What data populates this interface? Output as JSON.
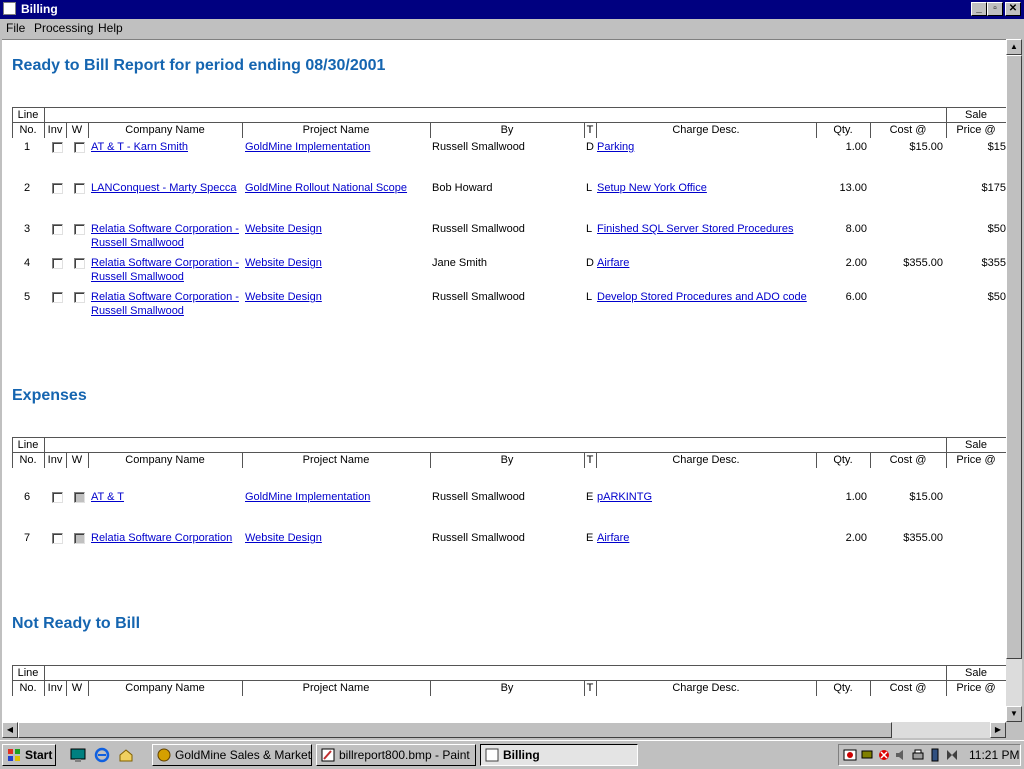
{
  "window": {
    "title": "Billing"
  },
  "menu": [
    "File",
    "Processing",
    "Help"
  ],
  "headers": {
    "line": "Line",
    "no": "No.",
    "inv": "Inv",
    "w": "W",
    "company": "Company Name",
    "project": "Project Name",
    "by": "By",
    "t": "T",
    "charge": "Charge Desc.",
    "qty": "Qty.",
    "cost": "Cost @",
    "sale": "Sale",
    "price": "Price @"
  },
  "sections": [
    {
      "title": "Ready to Bill Report for period ending 08/30/2001"
    },
    {
      "title": "Expenses"
    },
    {
      "title": "Not Ready to Bill"
    }
  ],
  "ready_rows": [
    {
      "no": "1",
      "company1": "AT & T - Karn Smith",
      "company2": "",
      "project": "GoldMine Implementation",
      "by": "Russell Smallwood",
      "t": "D",
      "charge": "Parking",
      "qty": "1.00",
      "cost": "$15.00",
      "price": "$15"
    },
    {
      "no": "2",
      "company1": "LANConquest - Marty Specca",
      "company2": "",
      "project": "GoldMine Rollout National Scope",
      "by": "Bob Howard",
      "t": "L",
      "charge": "Setup New York Office",
      "qty": "13.00",
      "cost": "",
      "price": "$175"
    },
    {
      "no": "3",
      "company1": "Relatia Software Corporation -",
      "company2": "Russell Smallwood",
      "project": "Website Design",
      "by": "Russell Smallwood",
      "t": "L",
      "charge": "Finished SQL Server Stored Procedures",
      "qty": "8.00",
      "cost": "",
      "price": "$50"
    },
    {
      "no": "4",
      "company1": "Relatia Software Corporation -",
      "company2": "Russell Smallwood",
      "project": "Website Design",
      "by": "Jane Smith",
      "t": "D",
      "charge": "Airfare",
      "qty": "2.00",
      "cost": "$355.00",
      "price": "$355"
    },
    {
      "no": "5",
      "company1": "Relatia Software Corporation -",
      "company2": "Russell Smallwood",
      "project": "Website Design",
      "by": "Russell Smallwood",
      "t": "L",
      "charge": "Develop Stored Procedures and ADO code",
      "qty": "6.00",
      "cost": "",
      "price": "$50"
    }
  ],
  "expense_rows": [
    {
      "no": "6",
      "company1": "AT & T",
      "project": "GoldMine Implementation",
      "by": "Russell Smallwood",
      "t": "E",
      "charge": "pARKINTG",
      "qty": "1.00",
      "cost": "$15.00"
    },
    {
      "no": "7",
      "company1": "Relatia Software Corporation",
      "project": "Website Design",
      "by": "Russell Smallwood",
      "t": "E",
      "charge": "Airfare",
      "qty": "2.00",
      "cost": "$355.00"
    }
  ],
  "taskbar": {
    "start": "Start",
    "tasks": [
      "GoldMine Sales & Marketing",
      "billreport800.bmp - Paint",
      "Billing"
    ],
    "clock": "11:21 PM"
  }
}
